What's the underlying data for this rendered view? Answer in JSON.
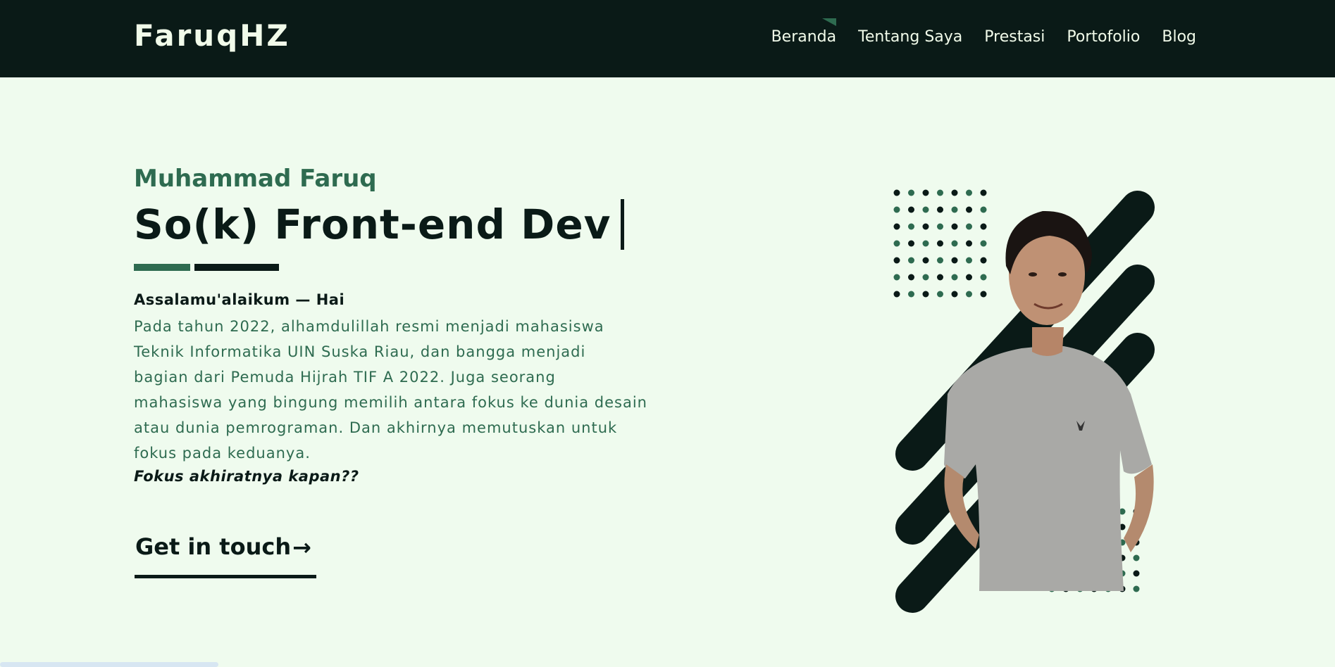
{
  "header": {
    "logo": "FaruqHZ",
    "nav": [
      {
        "label": "Beranda",
        "active": true
      },
      {
        "label": "Tentang Saya",
        "active": false
      },
      {
        "label": "Prestasi",
        "active": false
      },
      {
        "label": "Portofolio",
        "active": false
      },
      {
        "label": "Blog",
        "active": false
      }
    ]
  },
  "hero": {
    "name": "Muhammad Faruq",
    "headline": "So(k) Front-end Dev",
    "salam": "Assalamu'alaikum — Hai",
    "intro_lines": [
      "Pada tahun 2022, alhamdulillah resmi menjadi mahasiswa",
      "Teknik Informatika UIN Suska Riau, dan bangga menjadi",
      "bagian dari Pemuda Hijrah TIF A 2022. Juga seorang",
      "mahasiswa yang bingung memilih antara fokus ke dunia desain",
      "atau dunia pemrograman. Dan akhirnya memutuskan untuk",
      "fokus pada keduanya."
    ],
    "tagline": "Fokus akhiratnya kapan??",
    "cta_label": "Get in touch",
    "cta_icon": "arrow-right-icon"
  },
  "colors": {
    "background": "#effbee",
    "dark": "#0a1a17",
    "accent": "#2e6b50",
    "light_text": "#f1fbea"
  }
}
